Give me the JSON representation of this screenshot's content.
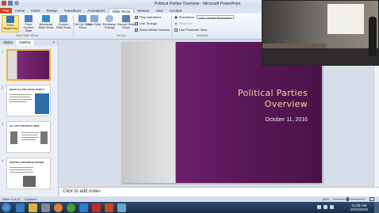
{
  "window": {
    "title": "Political Parties Overview - Microsoft PowerPoint"
  },
  "ribbon_tabs": [
    "File",
    "Home",
    "Insert",
    "Design",
    "Transitions",
    "Animations",
    "Slide Show",
    "Review",
    "View",
    "Acrobat"
  ],
  "ribbon": {
    "buttons": [
      {
        "label": "From Beginning"
      },
      {
        "label": "From Current Slide"
      },
      {
        "label": "Broadcast Slide Show"
      },
      {
        "label": "Custom Slide Show"
      },
      {
        "label": "Set Up Slide Show"
      },
      {
        "label": "Hide Slide"
      },
      {
        "label": "Rehearse Timings"
      },
      {
        "label": "Record Slide Show"
      }
    ],
    "checkboxes": [
      {
        "label": "Play Narrations",
        "checked": true
      },
      {
        "label": "Use Timings",
        "checked": true
      },
      {
        "label": "Show Media Controls",
        "checked": true
      },
      {
        "label": "Use Presenter View",
        "checked": false
      }
    ],
    "resolution_label": "Resolution:",
    "resolution_value": "Use Current Resolution",
    "show_on_label": "Show On:",
    "groups": [
      "Start Slide Show",
      "Set Up",
      "Monitors"
    ]
  },
  "left_pane": {
    "tabs": [
      "Slides",
      "Outline"
    ],
    "close": "×",
    "slides": [
      {
        "number": "1",
        "title": ""
      },
      {
        "number": "2",
        "title": "WHAT IS A POLITICAL PARTY?"
      },
      {
        "number": "3",
        "title": "ALL OUT POLITICAL WAR"
      },
      {
        "number": "4",
        "title": "PARTIES ARE BROAD-BASED"
      }
    ]
  },
  "slide": {
    "title": "Political Parties\nOverview",
    "date": "October 11, 2016"
  },
  "notes": {
    "placeholder": "Click to add notes"
  },
  "status_bar": {
    "slide_info": "Slide 1 of 12",
    "theme": "\"Opulent\"",
    "zoom": "66%"
  },
  "taskbar": {
    "time": "11:05 AM",
    "date": "10/11/2016"
  },
  "colors": {
    "slide_purple": "#6e1f6c",
    "title_gold": "#f4d9a4",
    "file_tab": "#c8491f"
  }
}
